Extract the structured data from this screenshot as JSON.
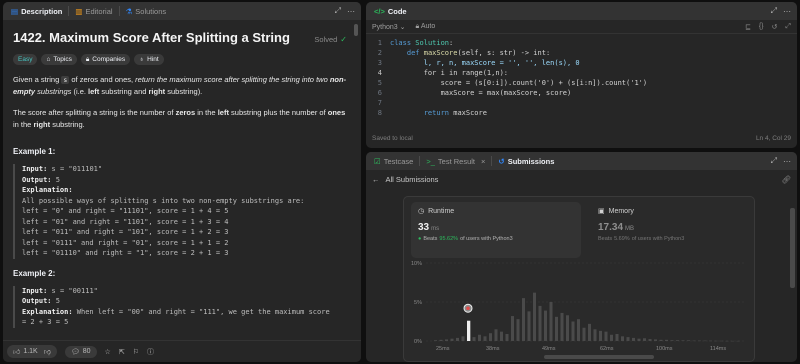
{
  "description_panel": {
    "tabs": [
      {
        "label": "Description",
        "active": true
      },
      {
        "label": "Editorial",
        "active": false
      },
      {
        "label": "Solutions",
        "active": false
      }
    ],
    "title": "1422. Maximum Score After Splitting a String",
    "status": "Solved",
    "tags": [
      "Easy",
      "Topics",
      "Companies",
      "Hint"
    ],
    "p1": {
      "a": "Given a string ",
      "code": "s",
      "b": " of zeros and ones, ",
      "c": "return the maximum score after splitting the string into two ",
      "d": "non-empty",
      "e": " substrings",
      "f": " (i.e. ",
      "g": "left",
      "h": " substring and ",
      "i": "right",
      "j": " substring)."
    },
    "p2": {
      "a": "The score after splitting a string is the number of ",
      "b": "zeros",
      "c": " in the ",
      "d": "left",
      "e": " substring plus the number of ",
      "f": "ones",
      "g": " in the ",
      "h": "right",
      "i": " substring."
    },
    "example1": {
      "heading": "Example 1:",
      "input_label": "Input:",
      "input": " s = \"011101\"",
      "output_label": "Output:",
      "output": " 5",
      "explanation_label": "Explanation:",
      "lines": [
        "All possible ways of splitting s into two non-empty substrings are:",
        "left = \"0\" and right = \"11101\", score = 1 + 4 = 5",
        "left = \"01\" and right = \"1101\", score = 1 + 3 = 4",
        "left = \"011\" and right = \"101\", score = 1 + 2 = 3",
        "left = \"0111\" and right = \"01\", score = 1 + 1 = 2",
        "left = \"01110\" and right = \"1\", score = 2 + 1 = 3"
      ]
    },
    "example2": {
      "heading": "Example 2:",
      "input_label": "Input:",
      "input": " s = \"00111\"",
      "output_label": "Output:",
      "output": " 5",
      "explanation_label": "Explanation:",
      "line1": " When left = \"00\" and right = \"111\", we get the maximum score",
      "line2": "= 2 + 3 = 5"
    },
    "footer": {
      "likes": "1.1K",
      "comments": "80"
    }
  },
  "code_panel": {
    "title": "Code",
    "language": "Python3",
    "mode": "Auto",
    "lines": [
      "1",
      "2",
      "3",
      "4",
      "5",
      "6",
      "7",
      "8"
    ],
    "code": {
      "l1_kw": "class",
      "l1_name": "Solution",
      "l2_kw": "def",
      "l2_fn": "maxScore",
      "l2_rest": "(self, s: str) -> int:",
      "l3": "l, r, n, maxScore = '', '', len(s), 0",
      "l4": "for i in range(1,n):",
      "l5": "score = (s[0:i]).count('0') + (s[i:n]).count('1')",
      "l6": "maxScore = max(maxScore, score)",
      "l8_kw": "return",
      "l8_rest": " maxScore"
    },
    "saved": "Saved to local",
    "cursor": "Ln 4, Col 29"
  },
  "results_panel": {
    "tabs": [
      {
        "label": "Testcase",
        "active": false
      },
      {
        "label": "Test Result",
        "active": false
      },
      {
        "label": "Submissions",
        "active": true
      }
    ],
    "back_label": "All Submissions",
    "runtime": {
      "label": "Runtime",
      "value": "33",
      "unit": "ms",
      "beats_prefix": "Beats",
      "beats_pct": "95.62%",
      "beats_suffix": "of users with Python3"
    },
    "memory": {
      "label": "Memory",
      "value": "17.34",
      "unit": "MB",
      "beats_prefix": "Beats",
      "beats_pct": "5.69%",
      "beats_suffix": "of users with Python3"
    }
  },
  "chart_data": {
    "type": "bar",
    "title": "",
    "xlabel": "",
    "ylabel": "",
    "ylim": [
      0,
      10
    ],
    "yticks": [
      "10%",
      "5%",
      "0%"
    ],
    "xticks": [
      "25ms",
      "38ms",
      "49ms",
      "62ms",
      "100ms",
      "114ms"
    ],
    "highlight_value_ms": 33,
    "bars": [
      0.1,
      0.15,
      0.2,
      0.3,
      0.4,
      0.6,
      0.3,
      0.5,
      0.8,
      0.6,
      1.0,
      1.5,
      1.2,
      0.9,
      3.2,
      2.8,
      5.5,
      3.8,
      6.2,
      4.5,
      3.9,
      5.0,
      3.1,
      3.6,
      3.3,
      2.5,
      2.8,
      1.7,
      2.2,
      1.5,
      1.3,
      1.2,
      0.8,
      0.9,
      0.6,
      0.5,
      0.4,
      0.3,
      0.35,
      0.25,
      0.2,
      0.15,
      0.15,
      0.1,
      0.1,
      0.08,
      0.08,
      0.05,
      0.05,
      0.05,
      0.04,
      0.03,
      0.03,
      0.02,
      0.02,
      0.02
    ]
  }
}
